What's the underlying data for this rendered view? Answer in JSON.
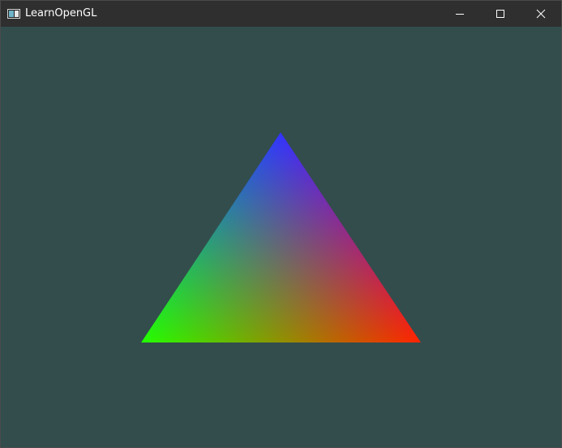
{
  "window": {
    "title": "LearnOpenGL",
    "clear_color": "#334d4d",
    "titlebar_color": "#2f2f2f"
  },
  "icons": {
    "app": "window-app-icon",
    "minimize": "minimize-icon",
    "maximize": "maximize-icon",
    "close": "close-icon"
  },
  "triangle": {
    "vertex_colors": {
      "top": "#0000ff",
      "bottom_left": "#00ff00",
      "bottom_right": "#ff0000"
    }
  }
}
